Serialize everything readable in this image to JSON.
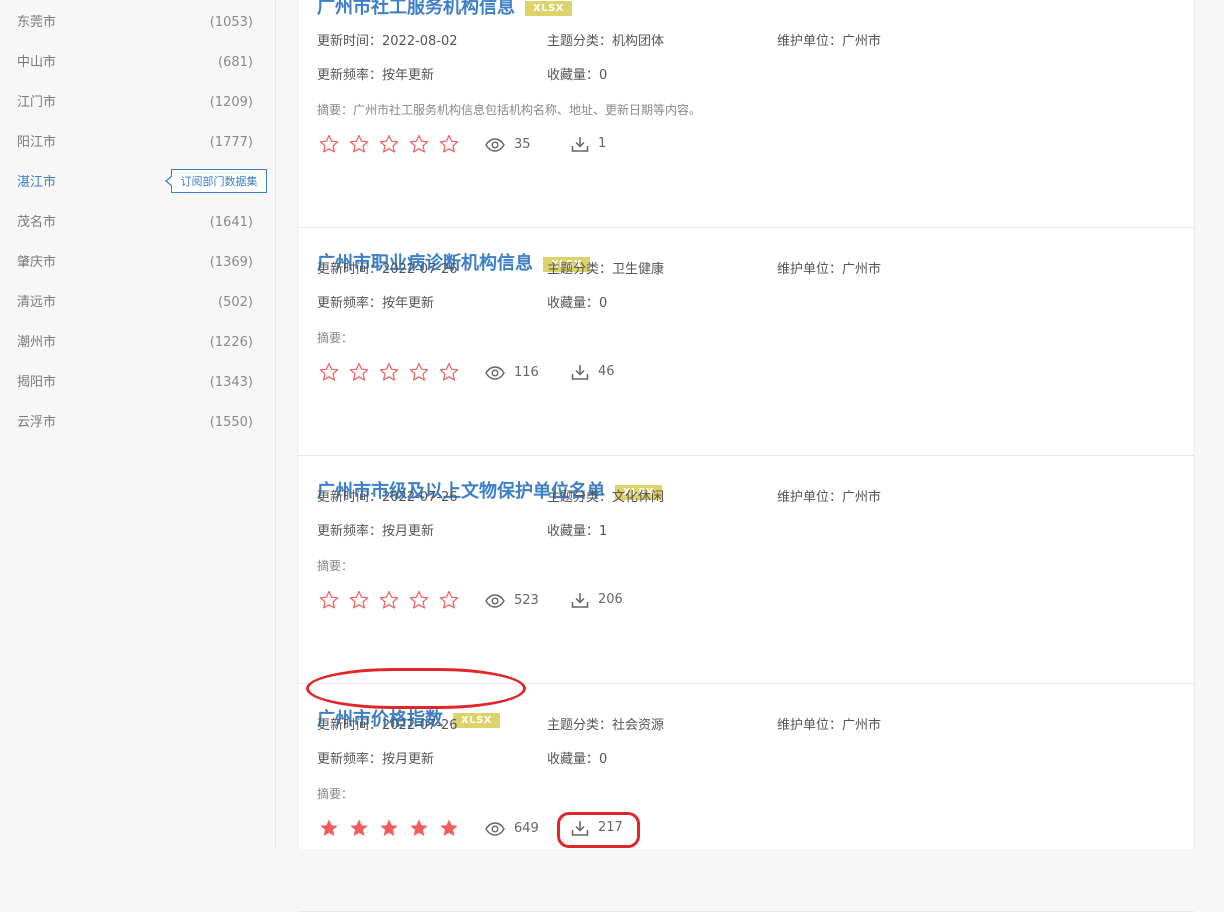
{
  "sidebar": {
    "cities": [
      {
        "name": "东莞市",
        "count": "(1053)"
      },
      {
        "name": "中山市",
        "count": "(681)"
      },
      {
        "name": "江门市",
        "count": "(1209)"
      },
      {
        "name": "阳江市",
        "count": "(1777)"
      },
      {
        "name": "湛江市",
        "count": ""
      },
      {
        "name": "茂名市",
        "count": "(1641)"
      },
      {
        "name": "肇庆市",
        "count": "(1369)"
      },
      {
        "name": "清远市",
        "count": "(502)"
      },
      {
        "name": "潮州市",
        "count": "(1226)"
      },
      {
        "name": "揭阳市",
        "count": "(1343)"
      },
      {
        "name": "云浮市",
        "count": "(1550)"
      }
    ],
    "tooltip": "订阅部门数据集"
  },
  "datasets": [
    {
      "title": "广州市社工服务机构信息",
      "format": "XLSX",
      "updated": "更新时间：2022-08-02",
      "category": "主题分类：机构团体",
      "maintainer": "维护单位：广州市",
      "frequency": "更新频率：按年更新",
      "favorites": "收藏量：0",
      "summary": "摘要：广州市社工服务机构信息包括机构名称、地址、更新日期等内容。",
      "rating": 0,
      "views": "35",
      "downloads": "1"
    },
    {
      "title": "广州市职业病诊断机构信息",
      "format": "XLSX",
      "updated": "更新时间：2022-07-26",
      "category": "主题分类：卫生健康",
      "maintainer": "维护单位：广州市",
      "frequency": "更新频率：按年更新",
      "favorites": "收藏量：0",
      "summary": "摘要：",
      "rating": 0,
      "views": "116",
      "downloads": "46"
    },
    {
      "title": "广州市市级及以上文物保护单位名单",
      "format": "XLSX",
      "updated": "更新时间：2022-07-26",
      "category": "主题分类：文化休闲",
      "maintainer": "维护单位：广州市",
      "frequency": "更新频率：按月更新",
      "favorites": "收藏量：1",
      "summary": "摘要：",
      "rating": 0,
      "views": "523",
      "downloads": "206"
    },
    {
      "title": "广州市价格指数",
      "format": "XLSX",
      "updated": "更新时间：2022-07-26",
      "category": "主题分类：社会资源",
      "maintainer": "维护单位：广州市",
      "frequency": "更新频率：按月更新",
      "favorites": "收藏量：0",
      "summary": "摘要：",
      "rating": 5,
      "views": "649",
      "downloads": "217"
    }
  ],
  "colors": {
    "link": "#3d7fc6",
    "star": "#f25c5c",
    "badge": "#dcd36b",
    "annotation": "#e0262a"
  }
}
